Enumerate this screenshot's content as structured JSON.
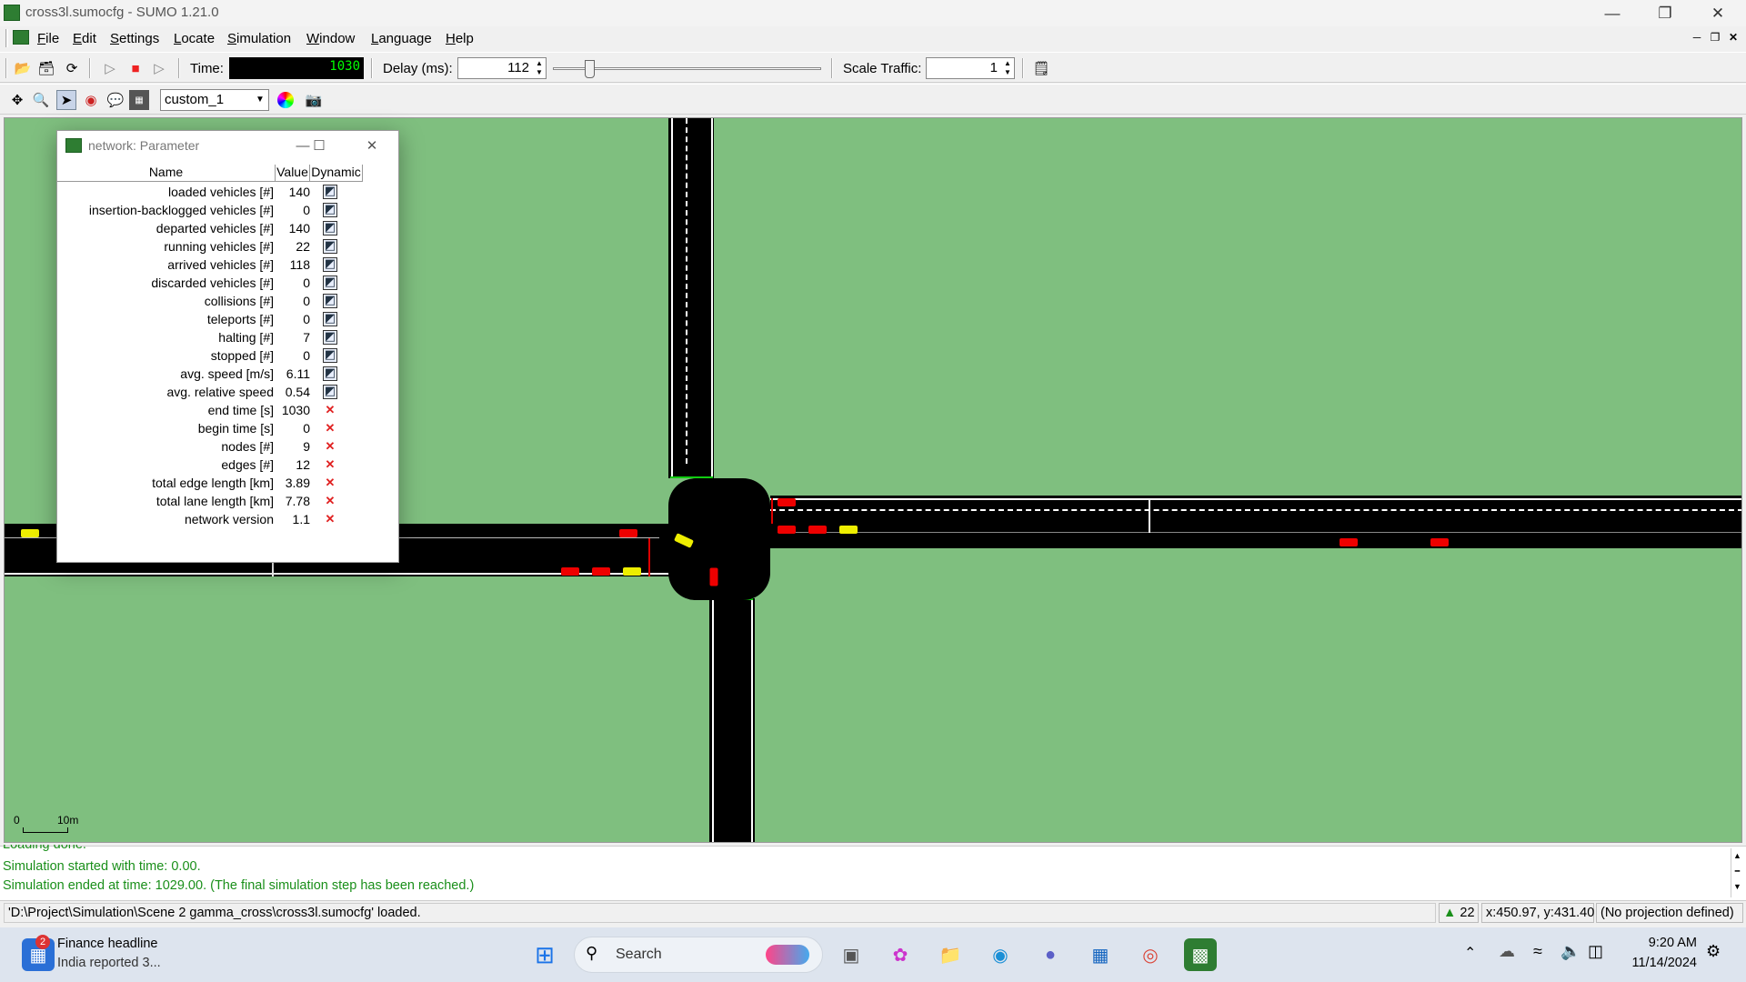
{
  "window": {
    "title": "cross3l.sumocfg - SUMO 1.21.0"
  },
  "menu": {
    "items": [
      {
        "label": "File",
        "accel": "F",
        "rest": "ile"
      },
      {
        "label": "Edit",
        "accel": "E",
        "rest": "dit"
      },
      {
        "label": "Settings",
        "accel": "S",
        "rest": "ettings"
      },
      {
        "label": "Locate",
        "accel": "L",
        "rest": "ocate"
      },
      {
        "label": "Simulation",
        "accel": "S",
        "rest": "imulation"
      },
      {
        "label": "Window",
        "accel": "W",
        "rest": "indow"
      },
      {
        "label": "Language",
        "accel": "L",
        "rest": "anguage"
      },
      {
        "label": "Help",
        "accel": "H",
        "rest": "elp"
      }
    ]
  },
  "toolbar": {
    "time_label": "Time:",
    "time_value": "1030",
    "delay_label": "Delay (ms):",
    "delay_value": "112",
    "delay_slider_fraction": 0.112,
    "scale_label": "Scale Traffic:",
    "scale_value": "1"
  },
  "viewbar": {
    "scheme": "custom_1"
  },
  "scale": {
    "zero": "0",
    "ten": "10m"
  },
  "param_window": {
    "title": "network: Parameter",
    "headers": {
      "name": "Name",
      "value": "Value",
      "dynamic": "Dynamic"
    },
    "rows": [
      {
        "name": "loaded vehicles [#]",
        "value": "140",
        "dynamic": true
      },
      {
        "name": "insertion-backlogged vehicles [#]",
        "value": "0",
        "dynamic": true
      },
      {
        "name": "departed vehicles [#]",
        "value": "140",
        "dynamic": true
      },
      {
        "name": "running vehicles [#]",
        "value": "22",
        "dynamic": true
      },
      {
        "name": "arrived vehicles [#]",
        "value": "118",
        "dynamic": true
      },
      {
        "name": "discarded vehicles [#]",
        "value": "0",
        "dynamic": true
      },
      {
        "name": "collisions [#]",
        "value": "0",
        "dynamic": true
      },
      {
        "name": "teleports [#]",
        "value": "0",
        "dynamic": true
      },
      {
        "name": "halting [#]",
        "value": "7",
        "dynamic": true
      },
      {
        "name": "stopped [#]",
        "value": "0",
        "dynamic": true
      },
      {
        "name": "avg. speed [m/s]",
        "value": "6.11",
        "dynamic": true
      },
      {
        "name": "avg. relative speed",
        "value": "0.54",
        "dynamic": true
      },
      {
        "name": "end time [s]",
        "value": "1030",
        "dynamic": false
      },
      {
        "name": "begin time [s]",
        "value": "0",
        "dynamic": false
      },
      {
        "name": "nodes [#]",
        "value": "9",
        "dynamic": false
      },
      {
        "name": "edges [#]",
        "value": "12",
        "dynamic": false
      },
      {
        "name": "total edge length [km]",
        "value": "3.89",
        "dynamic": false
      },
      {
        "name": "total lane length [km]",
        "value": "7.78",
        "dynamic": false
      },
      {
        "name": "network version",
        "value": "1.1",
        "dynamic": false
      }
    ]
  },
  "log": {
    "line0": "Loading done.",
    "line1": "Simulation started with time: 0.00.",
    "line2": "Simulation ended at time: 1029.00. (The final simulation step has been reached.)"
  },
  "status": {
    "message": "'D:\\Project\\Simulation\\Scene 2 gamma_cross\\cross3l.sumocfg' loaded.",
    "vehicles": "22",
    "coords": "x:450.97, y:431.40",
    "projection": "(No projection defined)"
  },
  "taskbar": {
    "widget_title": "Finance headline",
    "widget_sub": "India reported 3...",
    "widget_badge": "2",
    "search_label": "Search",
    "time": "9:20 AM",
    "date": "11/14/2024"
  },
  "colors": {
    "grass": "#7fbf7f",
    "road": "#000000",
    "log_green": "#1a8f1a"
  }
}
